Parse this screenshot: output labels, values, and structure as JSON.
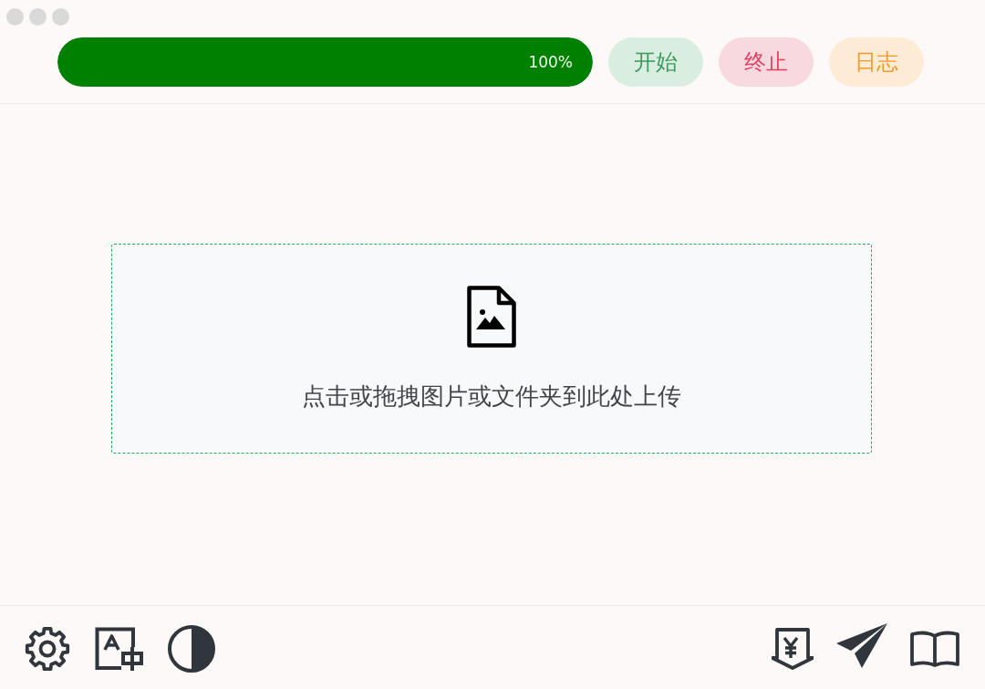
{
  "toolbar": {
    "progress": {
      "level": 1,
      "reading": "100%"
    },
    "buttons": [
      {
        "label": "开始",
        "kind": "start"
      },
      {
        "label": "终止",
        "kind": "stop"
      },
      {
        "label": "日志",
        "kind": "log"
      }
    ]
  },
  "upload_area": {
    "hint": "点击或拖拽图片或文件夹到此处上传"
  }
}
